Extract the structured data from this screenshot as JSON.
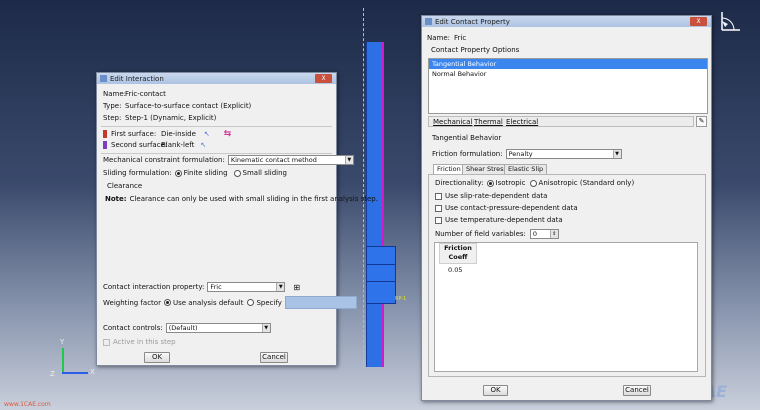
{
  "viewport": {
    "rp_label": "RP-1",
    "axis_x": "X",
    "axis_y": "Y",
    "axis_z": "Z",
    "watermark_left": "www.1CAE.com",
    "watermark_cae": "CAE"
  },
  "edit_interaction": {
    "title": "Edit Interaction",
    "close": "X",
    "name_label": "Name:",
    "name_value": "Fric-contact",
    "type_label": "Type:",
    "type_value": "Surface-to-surface contact (Explicit)",
    "step_label": "Step:",
    "step_value": "Step-1 (Dynamic, Explicit)",
    "first_surface_label": "First surface:",
    "first_surface_value": "Die-inside",
    "second_surface_label": "Second surface:",
    "second_surface_value": "Blank-left",
    "mech_label": "Mechanical constraint formulation:",
    "mech_value": "Kinematic contact method",
    "sliding_label": "Sliding formulation:",
    "finite_sliding": "Finite sliding",
    "small_sliding": "Small sliding",
    "clearance": "Clearance",
    "note_label": "Note:",
    "note_text": "Clearance can only be used with small sliding in the first analysis step.",
    "cip_label": "Contact interaction property:",
    "cip_value": "Fric",
    "weighting_label": "Weighting factor",
    "use_default": "Use analysis default",
    "specify": "Specify",
    "controls_label": "Contact controls:",
    "controls_value": "(Default)",
    "active_label": "Active in this step",
    "ok": "OK",
    "cancel": "Cancel"
  },
  "edit_contact_property": {
    "title": "Edit Contact Property",
    "close": "X",
    "name_label": "Name:",
    "name_value": "Fric",
    "options_label": "Contact Property Options",
    "options": [
      "Tangential Behavior",
      "Normal Behavior"
    ],
    "menus": [
      "Mechanical",
      "Thermal",
      "Electrical"
    ],
    "section_title": "Tangential Behavior",
    "friction_formulation_label": "Friction formulation:",
    "friction_formulation_value": "Penalty",
    "tabs": [
      "Friction",
      "Shear Stress",
      "Elastic Slip"
    ],
    "directionality_label": "Directionality:",
    "isotropic": "Isotropic",
    "anisotropic": "Anisotropic (Standard only)",
    "checks": [
      "Use slip-rate-dependent data",
      "Use contact-pressure-dependent data",
      "Use temperature-dependent data"
    ],
    "field_vars_label": "Number of field variables:",
    "field_vars_value": "0",
    "table_header_1": "Friction",
    "table_header_2": "Coeff",
    "table_value": "0.05",
    "ok": "OK",
    "cancel": "Cancel"
  },
  "colors": {
    "selection": "#3a86ee",
    "beam": "#2d6fe4",
    "magenta": "#d21ac8"
  }
}
